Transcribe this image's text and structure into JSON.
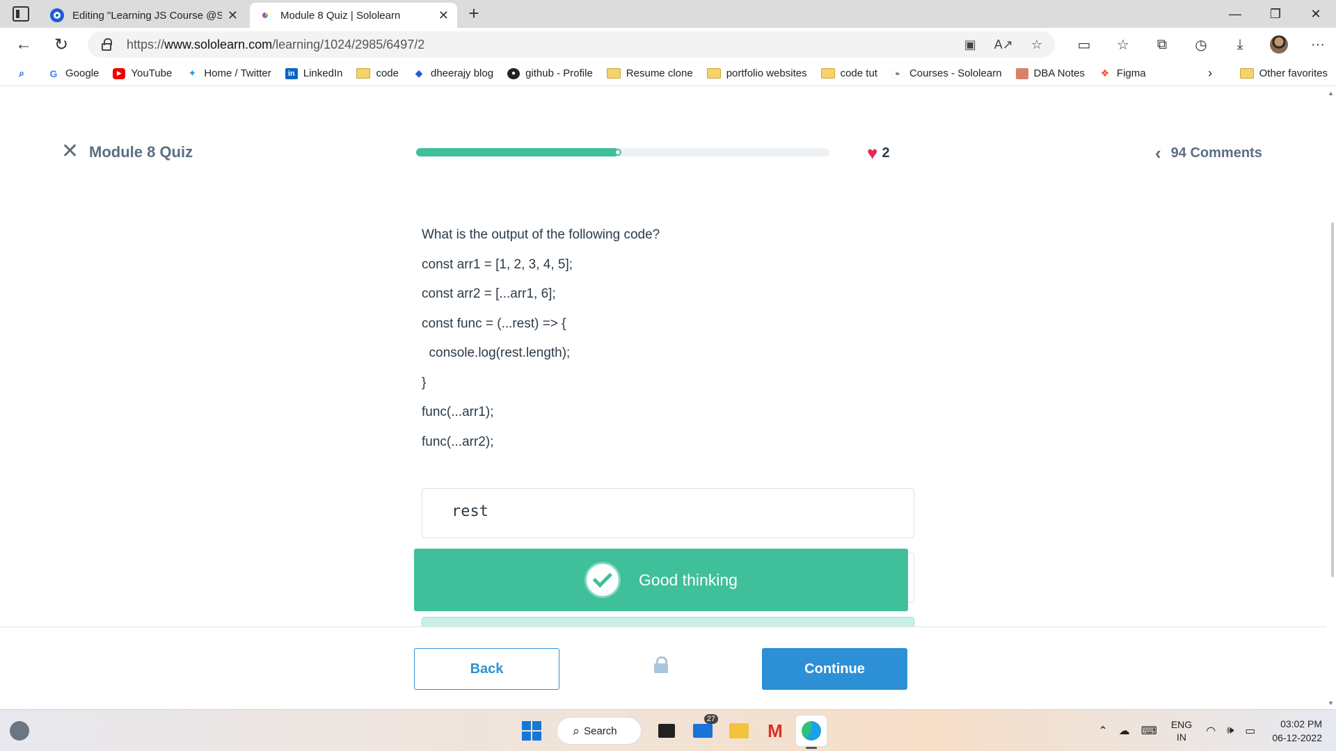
{
  "browser": {
    "tabs": [
      {
        "title": "Editing \"Learning JS Course @Sc",
        "active": false
      },
      {
        "title": "Module 8 Quiz | Sololearn",
        "active": true
      }
    ],
    "url_prefix": "https://",
    "url_host": "www.sololearn.com",
    "url_path": "/learning/1024/2985/6497/2",
    "bookmarks": [
      {
        "label": "Google",
        "icon": "google-icon"
      },
      {
        "label": "YouTube",
        "icon": "youtube-icon"
      },
      {
        "label": "Home / Twitter",
        "icon": "twitter-icon"
      },
      {
        "label": "LinkedIn",
        "icon": "linkedin-icon"
      },
      {
        "label": "code",
        "icon": "folder-icon"
      },
      {
        "label": "dheerajy blog",
        "icon": "blog-icon"
      },
      {
        "label": "github - Profile",
        "icon": "github-icon"
      },
      {
        "label": "Resume clone",
        "icon": "folder-icon"
      },
      {
        "label": "portfolio websites",
        "icon": "folder-icon"
      },
      {
        "label": "code tut",
        "icon": "folder-icon"
      },
      {
        "label": "Courses - Sololearn",
        "icon": "sololearn-icon"
      },
      {
        "label": "DBA Notes",
        "icon": "notes-icon"
      },
      {
        "label": "Figma",
        "icon": "figma-icon"
      }
    ],
    "other_favorites": "Other favorites"
  },
  "quiz": {
    "title": "Module 8 Quiz",
    "progress_fraction": 0.49,
    "lives": "2",
    "comments": "94 Comments",
    "question_lines": [
      "What is the output of the following code?",
      "const arr1 = [1, 2, 3, 4, 5];",
      "const arr2 = [...arr1, 6];",
      "const func = (...rest) => {",
      "  console.log(rest.length);",
      "}",
      "func(...arr1);",
      "func(...arr2);"
    ],
    "answer": "rest",
    "feedback": "Good thinking",
    "back_label": "Back",
    "continue_label": "Continue"
  },
  "taskbar": {
    "search_label": "Search",
    "mail_badge": "27",
    "lang_line1": "ENG",
    "lang_line2": "IN",
    "time": "03:02 PM",
    "date": "06-12-2022"
  },
  "colors": {
    "accent_green": "#3fbf9a",
    "accent_blue": "#2d8fd6",
    "heart": "#e52956"
  }
}
